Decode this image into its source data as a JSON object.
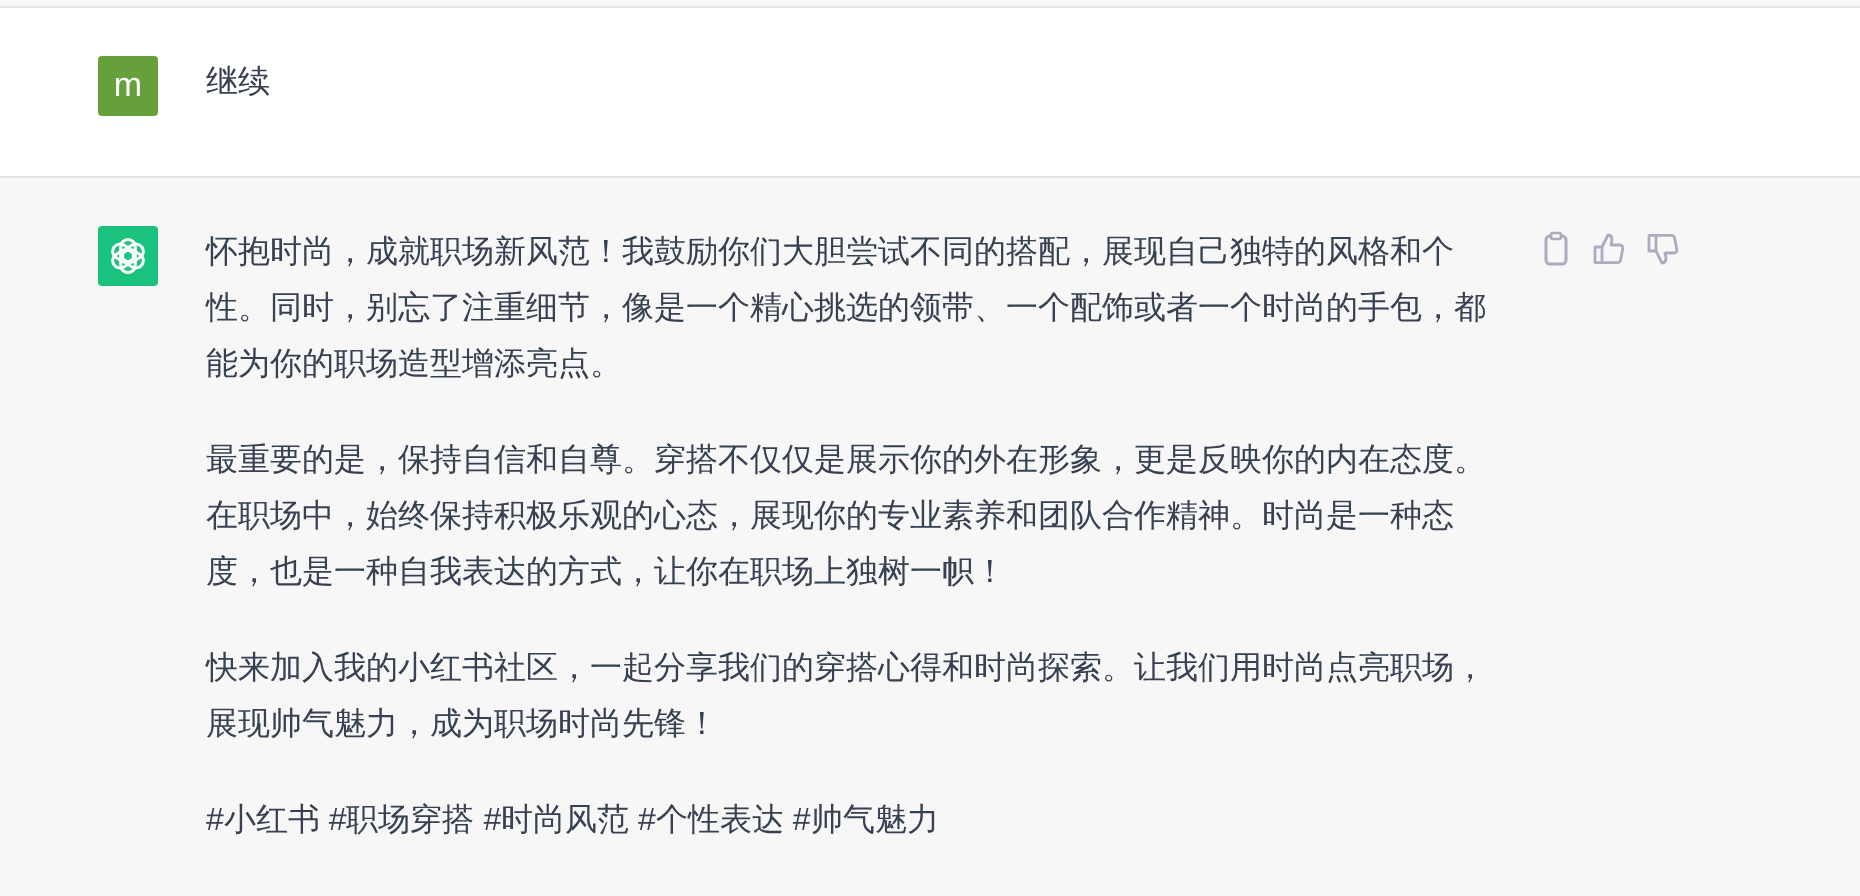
{
  "messages": [
    {
      "kind": "user",
      "avatar": "m",
      "paragraphs": [
        "继续"
      ]
    },
    {
      "kind": "assistant",
      "paragraphs": [
        "怀抱时尚，成就职场新风范！我鼓励你们大胆尝试不同的搭配，展现自己独特的风格和个性。同时，别忘了注重细节，像是一个精心挑选的领带、一个配饰或者一个时尚的手包，都能为你的职场造型增添亮点。",
        "最重要的是，保持自信和自尊。穿搭不仅仅是展示你的外在形象，更是反映你的内在态度。在职场中，始终保持积极乐观的心态，展现你的专业素养和团队合作精神。时尚是一种态度，也是一种自我表达的方式，让你在职场上独树一帜！",
        "快来加入我的小红书社区，一起分享我们的穿搭心得和时尚探索。让我们用时尚点亮职场，展现帅气魅力，成为职场时尚先锋！",
        "#小红书 #职场穿搭 #时尚风范 #个性表达 #帅气魅力"
      ]
    }
  ]
}
